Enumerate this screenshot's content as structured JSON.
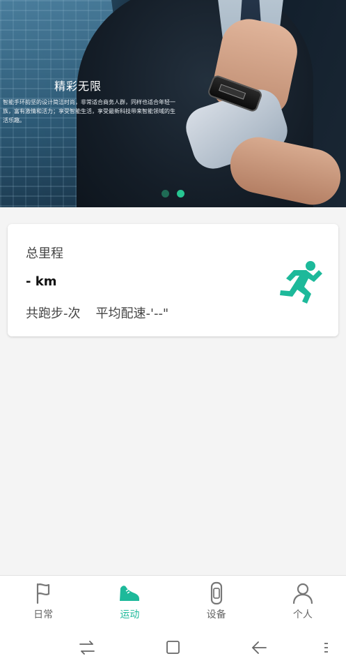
{
  "banner": {
    "title": "精彩无限",
    "description": "智能手环韵坚的设计简洁时尚，非常适合商务人群，同样也适合年轻一族，富有激情和活力；享受智能生活，享受最新科技带来智能领域的生活乐趣。",
    "page_count": 2,
    "active_index": 1,
    "colors": {
      "dot_active": "#27c692",
      "dot_inactive": "#1f6b55"
    }
  },
  "summary": {
    "title": "总里程",
    "distance": "- km",
    "run_count": "共跑步-次",
    "avg_pace": "平均配速-'--\"",
    "icon": "running-man-icon",
    "accent": "#1db99a"
  },
  "tabs": [
    {
      "label": "日常",
      "icon": "flag-icon",
      "active": false
    },
    {
      "label": "运动",
      "icon": "sneaker-icon",
      "active": true
    },
    {
      "label": "设备",
      "icon": "watch-band-icon",
      "active": false
    },
    {
      "label": "个人",
      "icon": "person-icon",
      "active": false
    }
  ],
  "system_nav": [
    "switch-icon",
    "home-square-icon",
    "back-arrow-icon",
    "menu-dots-icon"
  ]
}
